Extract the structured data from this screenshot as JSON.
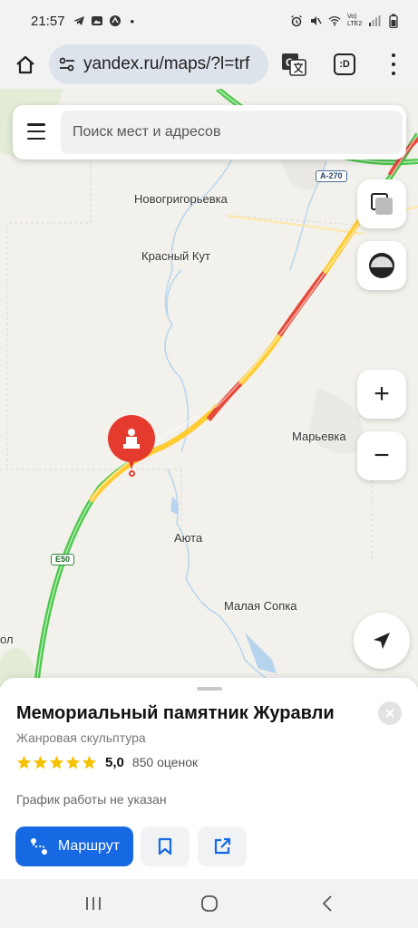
{
  "status_bar": {
    "time": "21:57",
    "dot": "•",
    "lte_label": "Vo) LTE2",
    "left_icons": [
      "telegram-icon",
      "gallery-icon",
      "app-icon"
    ],
    "right_icons": [
      "alarm-icon",
      "mute-icon",
      "wifi-icon",
      "signal-icon",
      "battery-icon"
    ]
  },
  "browser": {
    "url": "yandex.ru/maps/?l=trf",
    "tab_count_label": ":D",
    "icons": [
      "home-icon",
      "site-settings-icon",
      "translate-icon",
      "menu-icon"
    ]
  },
  "search": {
    "placeholder": "Поиск мест и адресов"
  },
  "map": {
    "labels": {
      "novogrigorevka": "Новогригорьевка",
      "krasny_kut": "Красный Кут",
      "maryevka": "Марьевка",
      "ayuta": "Аюта",
      "malaya_sopka": "Малая Сопка",
      "edge": "ол"
    },
    "road_shields": {
      "a270": "A-270",
      "e50": "E50"
    },
    "traffic_colors": {
      "free": "#4cc94c",
      "slow": "#ffcc33",
      "jam": "#e64a3b"
    },
    "controls": {
      "zoom_in": "+",
      "zoom_out": "−"
    }
  },
  "place": {
    "title": "Мемориальный памятник Журавли",
    "category": "Жанровая скульптура",
    "rating_value": "5,0",
    "rating_stars": 5,
    "rating_count": "850 оценок",
    "hours": "График работы не указан",
    "route_label": "Маршрут",
    "accent_color": "#1668e3"
  }
}
